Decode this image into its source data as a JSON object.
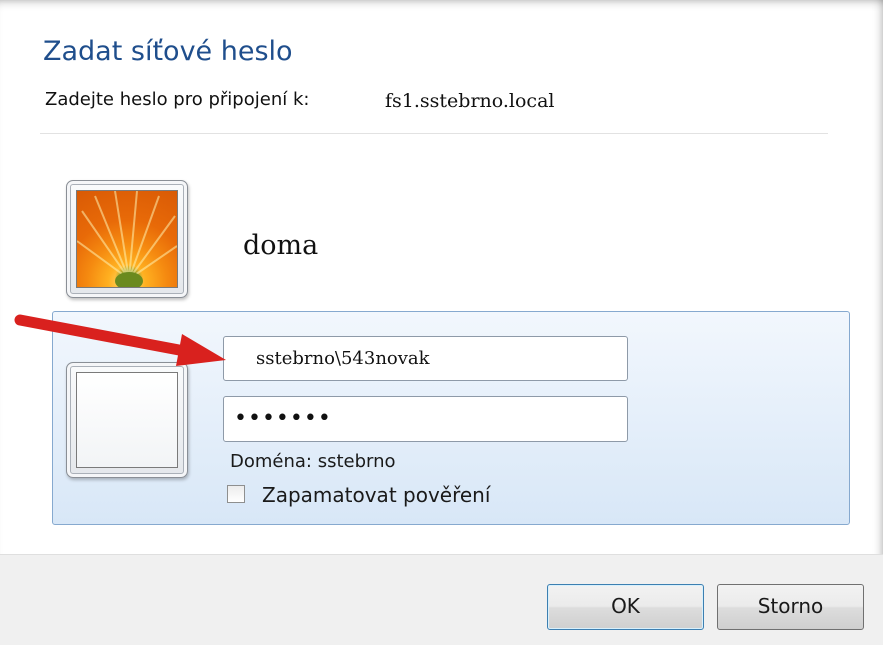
{
  "dialog": {
    "title": "Zadat síťové heslo",
    "subtitle_label": "Zadejte heslo pro připojení k:",
    "server_name": "fs1.sstebrno.local"
  },
  "saved_account": {
    "name": "doma"
  },
  "credentials": {
    "username_value": "sstebrno\\543novak",
    "password_mask": "•••••••",
    "domain_text": "Doména: sstebrno",
    "remember_label": "Zapamatovat pověření",
    "remember_checked": false
  },
  "buttons": {
    "ok_label": "OK",
    "cancel_label": "Storno"
  },
  "colors": {
    "title": "#1f4e8c",
    "panel_border": "#86a9cf",
    "arrow": "#d9211e"
  }
}
